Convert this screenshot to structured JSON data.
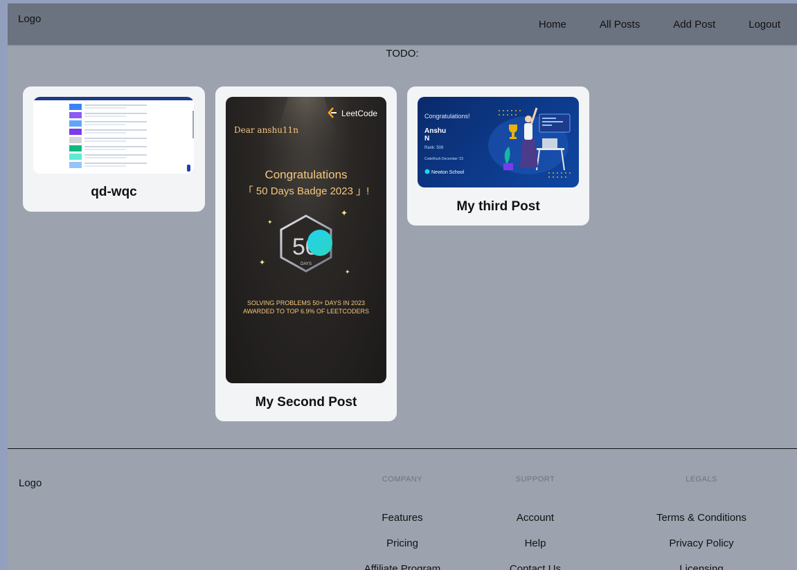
{
  "nav": {
    "logo": "Logo",
    "items": [
      "Home",
      "All Posts",
      "Add Post",
      "Logout"
    ]
  },
  "todo": "TODO:",
  "posts": [
    {
      "title": "qd-wqc",
      "image_desc_icon": "screenshot-thumbnail"
    },
    {
      "title": "My Second Post",
      "image": {
        "brand": "LeetCode",
        "greeting": "Dear anshu11n",
        "heading": "Congratulations",
        "badge": "「 50 Days Badge 2023 」!",
        "badge_number": "50",
        "badge_sub": "DAYS",
        "line1": "SOLVING PROBLEMS 50+ DAYS IN 2023",
        "line2": "AWARDED TO TOP 6.9% OF LEETCODERS"
      }
    },
    {
      "title": "My third Post",
      "image": {
        "heading": "Congratulations!",
        "name1": "Anshu",
        "name2": "N",
        "rank": "Rank: 508",
        "event": "CodeRush December '23",
        "brand": "Newton School"
      }
    }
  ],
  "footer": {
    "logo": "Logo",
    "columns": [
      {
        "heading": "Company",
        "links": [
          "Features",
          "Pricing",
          "Affiliate Program"
        ]
      },
      {
        "heading": "Support",
        "links": [
          "Account",
          "Help",
          "Contact Us"
        ]
      },
      {
        "heading": "Legals",
        "links": [
          "Terms & Conditions",
          "Privacy Policy",
          "Licensing"
        ]
      }
    ]
  },
  "colors": {
    "page_bg": "#9ca3af",
    "navbar_bg": "#6b7280",
    "card_bg": "#f3f4f6",
    "leetcode_gold": "#f5c77e",
    "newton_blue": "#0d3a8a"
  }
}
